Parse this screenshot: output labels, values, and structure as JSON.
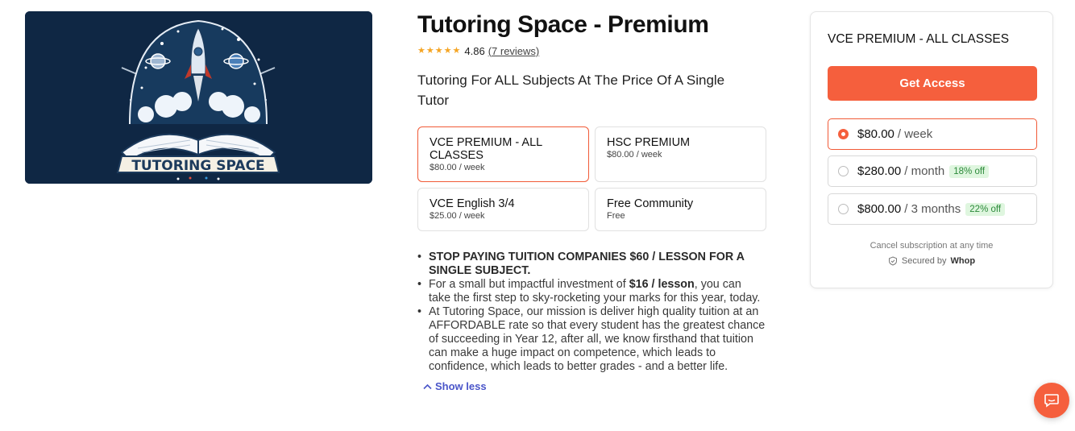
{
  "product": {
    "title": "Tutoring Space - Premium",
    "rating": "4.86",
    "reviews_link": "(7 reviews)",
    "stars": 4.86,
    "subtitle": "Tutoring For ALL Subjects At The Price Of A Single Tutor",
    "banner_logo_text": "TUTORING SPACE"
  },
  "plans": [
    {
      "name": "VCE PREMIUM - ALL CLASSES",
      "price": "$80.00 / week",
      "selected": true
    },
    {
      "name": "HSC PREMIUM",
      "price": "$80.00 / week",
      "selected": false
    },
    {
      "name": "VCE English 3/4",
      "price": "$25.00 / week",
      "selected": false
    },
    {
      "name": "Free Community",
      "price": "Free",
      "selected": false
    }
  ],
  "description": {
    "bullet1": "STOP PAYING TUITION COMPANIES $60 / LESSON FOR A SINGLE SUBJECT.",
    "bullet2_pre": "For a small but impactful investment of ",
    "bullet2_bold": "$16 / lesson",
    "bullet2_post": ", you can take the first step to sky-rocketing your marks for this year, today.",
    "bullet3": "At Tutoring Space, our mission is deliver high quality tuition at an AFFORDABLE rate so that every student has the greatest chance of succeeding in Year 12, after all, we know firsthand that tuition can make a huge impact on competence, which leads to confidence, which leads to better grades - and a better life.",
    "show_less": "Show less"
  },
  "card": {
    "title": "VCE PREMIUM - ALL CLASSES",
    "button": "Get Access",
    "options": [
      {
        "price": "$80.00",
        "period": "/ week",
        "discount": "",
        "selected": true
      },
      {
        "price": "$280.00",
        "period": "/ month",
        "discount": "18% off",
        "selected": false
      },
      {
        "price": "$800.00",
        "period": "/ 3 months",
        "discount": "22% off",
        "selected": false
      }
    ],
    "cancel_text": "Cancel subscription at any time",
    "secured_prefix": "Secured by",
    "secured_brand": "Whop"
  },
  "colors": {
    "accent": "#f55f3d",
    "selected_border": "#f15a37",
    "discount_bg": "#dff6df",
    "discount_text": "#2c8a3a",
    "star": "#f5a524",
    "link": "#4a55c9"
  },
  "icons": {
    "chat": "chat-bubble-icon",
    "shield": "shield-check-icon",
    "chevron": "chevron-up-icon",
    "star": "star-icon"
  }
}
